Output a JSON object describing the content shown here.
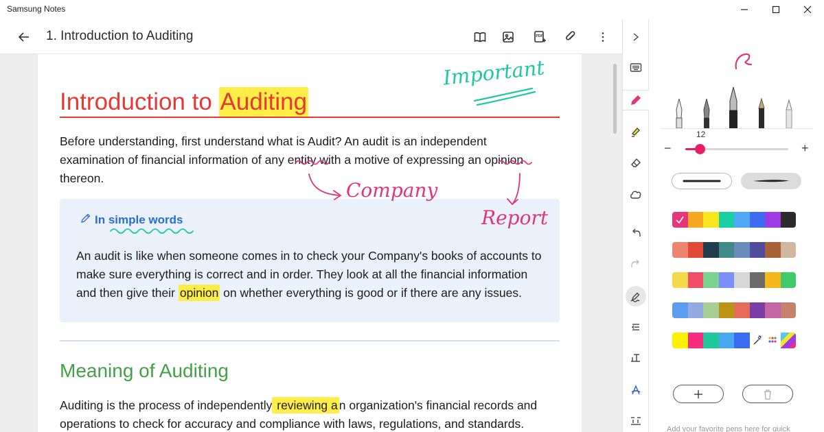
{
  "app": {
    "title": "Samsung Notes",
    "window_controls": [
      "minimize-icon",
      "maximize-icon",
      "close-icon"
    ]
  },
  "header": {
    "title": "1. Introduction to Auditing",
    "icons": [
      "book-view-icon",
      "image-icon",
      "pdf-export-icon",
      "attachment-icon",
      "more-icon"
    ]
  },
  "note": {
    "heading": {
      "before": "Introduction to ",
      "highlight": "Auditing",
      "color": "#e53935"
    },
    "intro": {
      "line1": "Before understanding, first understand what is Audit? An audit is an independent",
      "line2_a": "examination of financial information of any ",
      "line2_entity": "entity",
      "line2_b": " with a motive of expressing an ",
      "line2_opinion": "opinion",
      "line3": "thereon."
    },
    "callout": {
      "title": "In simple words",
      "line1": "An audit is like when someone comes in to check your Company's books of accounts to",
      "line2": "make sure everything is correct and in order. They look at all the financial information",
      "line3_a": "and then give their ",
      "line3_highlight": "opinion",
      "line3_b": " on whether everything is good or if there are any issues."
    },
    "subheading": {
      "text": "Meaning of Auditing",
      "color": "#43a047"
    },
    "meaning": {
      "line1_a": "Auditing is the process of independently",
      "line1_highlight": " reviewing a",
      "line1_b": "n organization's financial records and",
      "line2": "operations to check for accuracy and compliance with laws, regulations, and standards."
    },
    "handwriting": {
      "important": "Important",
      "company": "Company",
      "report": "Report",
      "ink_teal": "#1ec8a0",
      "ink_pink": "#e0357a"
    }
  },
  "tools": [
    "collapse-panel-icon",
    "keyboard-icon",
    "pen-icon",
    "highlighter-icon",
    "eraser-icon",
    "lasso-icon",
    "undo-icon",
    "redo-icon",
    "pen-to-text-icon",
    "text-align-icon",
    "text-format-icon",
    "handwriting-font-icon",
    "text-layout-icon"
  ],
  "pen_panel": {
    "size": "12",
    "size_fraction": 0.14,
    "accent": "#e91e63",
    "palette": [
      [
        "#e8357a",
        "#f7a823",
        "#f7e61e",
        "#19d1a0",
        "#4fa7f5",
        "#3c6df0",
        "#9d3be6",
        "#2b2b2b"
      ],
      [
        "#ee8470",
        "#e04a35",
        "#1f3d4f",
        "#3f8a86",
        "#6a8cba",
        "#534b9c",
        "#a76238",
        "#d1b79f"
      ],
      [
        "#f6d94b",
        "#ee4f67",
        "#7ad38e",
        "#7c8ef8",
        "#d7d7d7",
        "#6b6b6b",
        "#f4b81c",
        "#3ecb6a"
      ],
      [
        "#5d9cf0",
        "#92a9e2",
        "#a6cf96",
        "#bc9314",
        "#e56b5b",
        "#7a3ea6",
        "#c465a6",
        "#c5826c"
      ],
      [
        "#fef000",
        "#f52d7c",
        "#1ec89a",
        "#4aa8f0",
        "#3a6cf2",
        "#ffffff",
        "#ffffff",
        "#56c7f2"
      ]
    ],
    "hint": "Add your favorite pens here for quick"
  }
}
